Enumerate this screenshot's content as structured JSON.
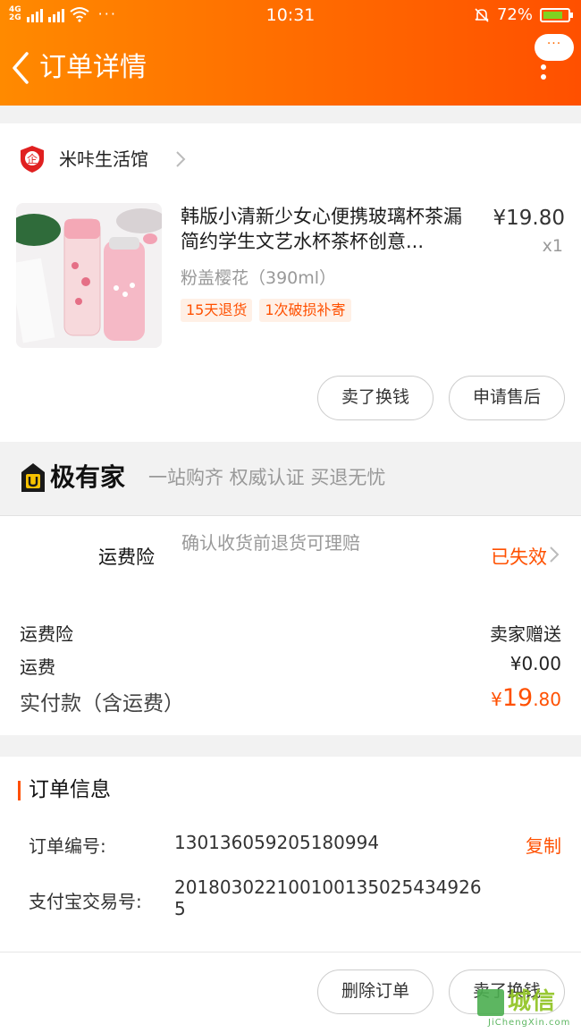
{
  "status_bar": {
    "network_1": "4G",
    "network_2": "2G",
    "time": "10:31",
    "battery": "72%",
    "more": "···"
  },
  "nav": {
    "title": "订单详情",
    "more_bubble": "···"
  },
  "shop": {
    "name": "米咔生活馆",
    "badge": "企"
  },
  "product": {
    "title": "韩版小清新少女心便携玻璃杯茶漏简约学生文艺水杯茶杯创意...",
    "price": "¥19.80",
    "quantity": "x1",
    "sku": "粉盖樱花（390ml）",
    "tags": [
      "15天退货",
      "1次破损补寄"
    ]
  },
  "actions_top": {
    "sell_label": "卖了换钱",
    "after_sales_label": "申请售后"
  },
  "promo": {
    "brand": "极有家",
    "slogan": "一站购齐 权威认证 买退无忧"
  },
  "insurance": {
    "label": "运费险",
    "description": "确认收货前退货可理赔",
    "status": "已失效"
  },
  "fees": {
    "insurance_label": "运费险",
    "insurance_value": "卖家赠送",
    "shipping_label": "运费",
    "shipping_value": "¥0.00",
    "total_label": "实付款（含运费）",
    "total_currency": "¥",
    "total_integer": "19",
    "total_decimal": ".80"
  },
  "order_info": {
    "section_title": "订单信息",
    "order_no_label": "订单编号:",
    "order_no": "130136059205180994",
    "copy_label": "复制",
    "alipay_label": "支付宝交易号:",
    "alipay_no": "2018030221001001350254349265"
  },
  "actions_bottom": {
    "delete_label": "删除订单",
    "sell_label": "卖了换钱"
  },
  "watermark": {
    "text": "城信",
    "sub": "JiChengXin.com"
  },
  "colors": {
    "accent": "#ff5000",
    "header_start": "#ff8a00",
    "header_end": "#ff5000"
  }
}
